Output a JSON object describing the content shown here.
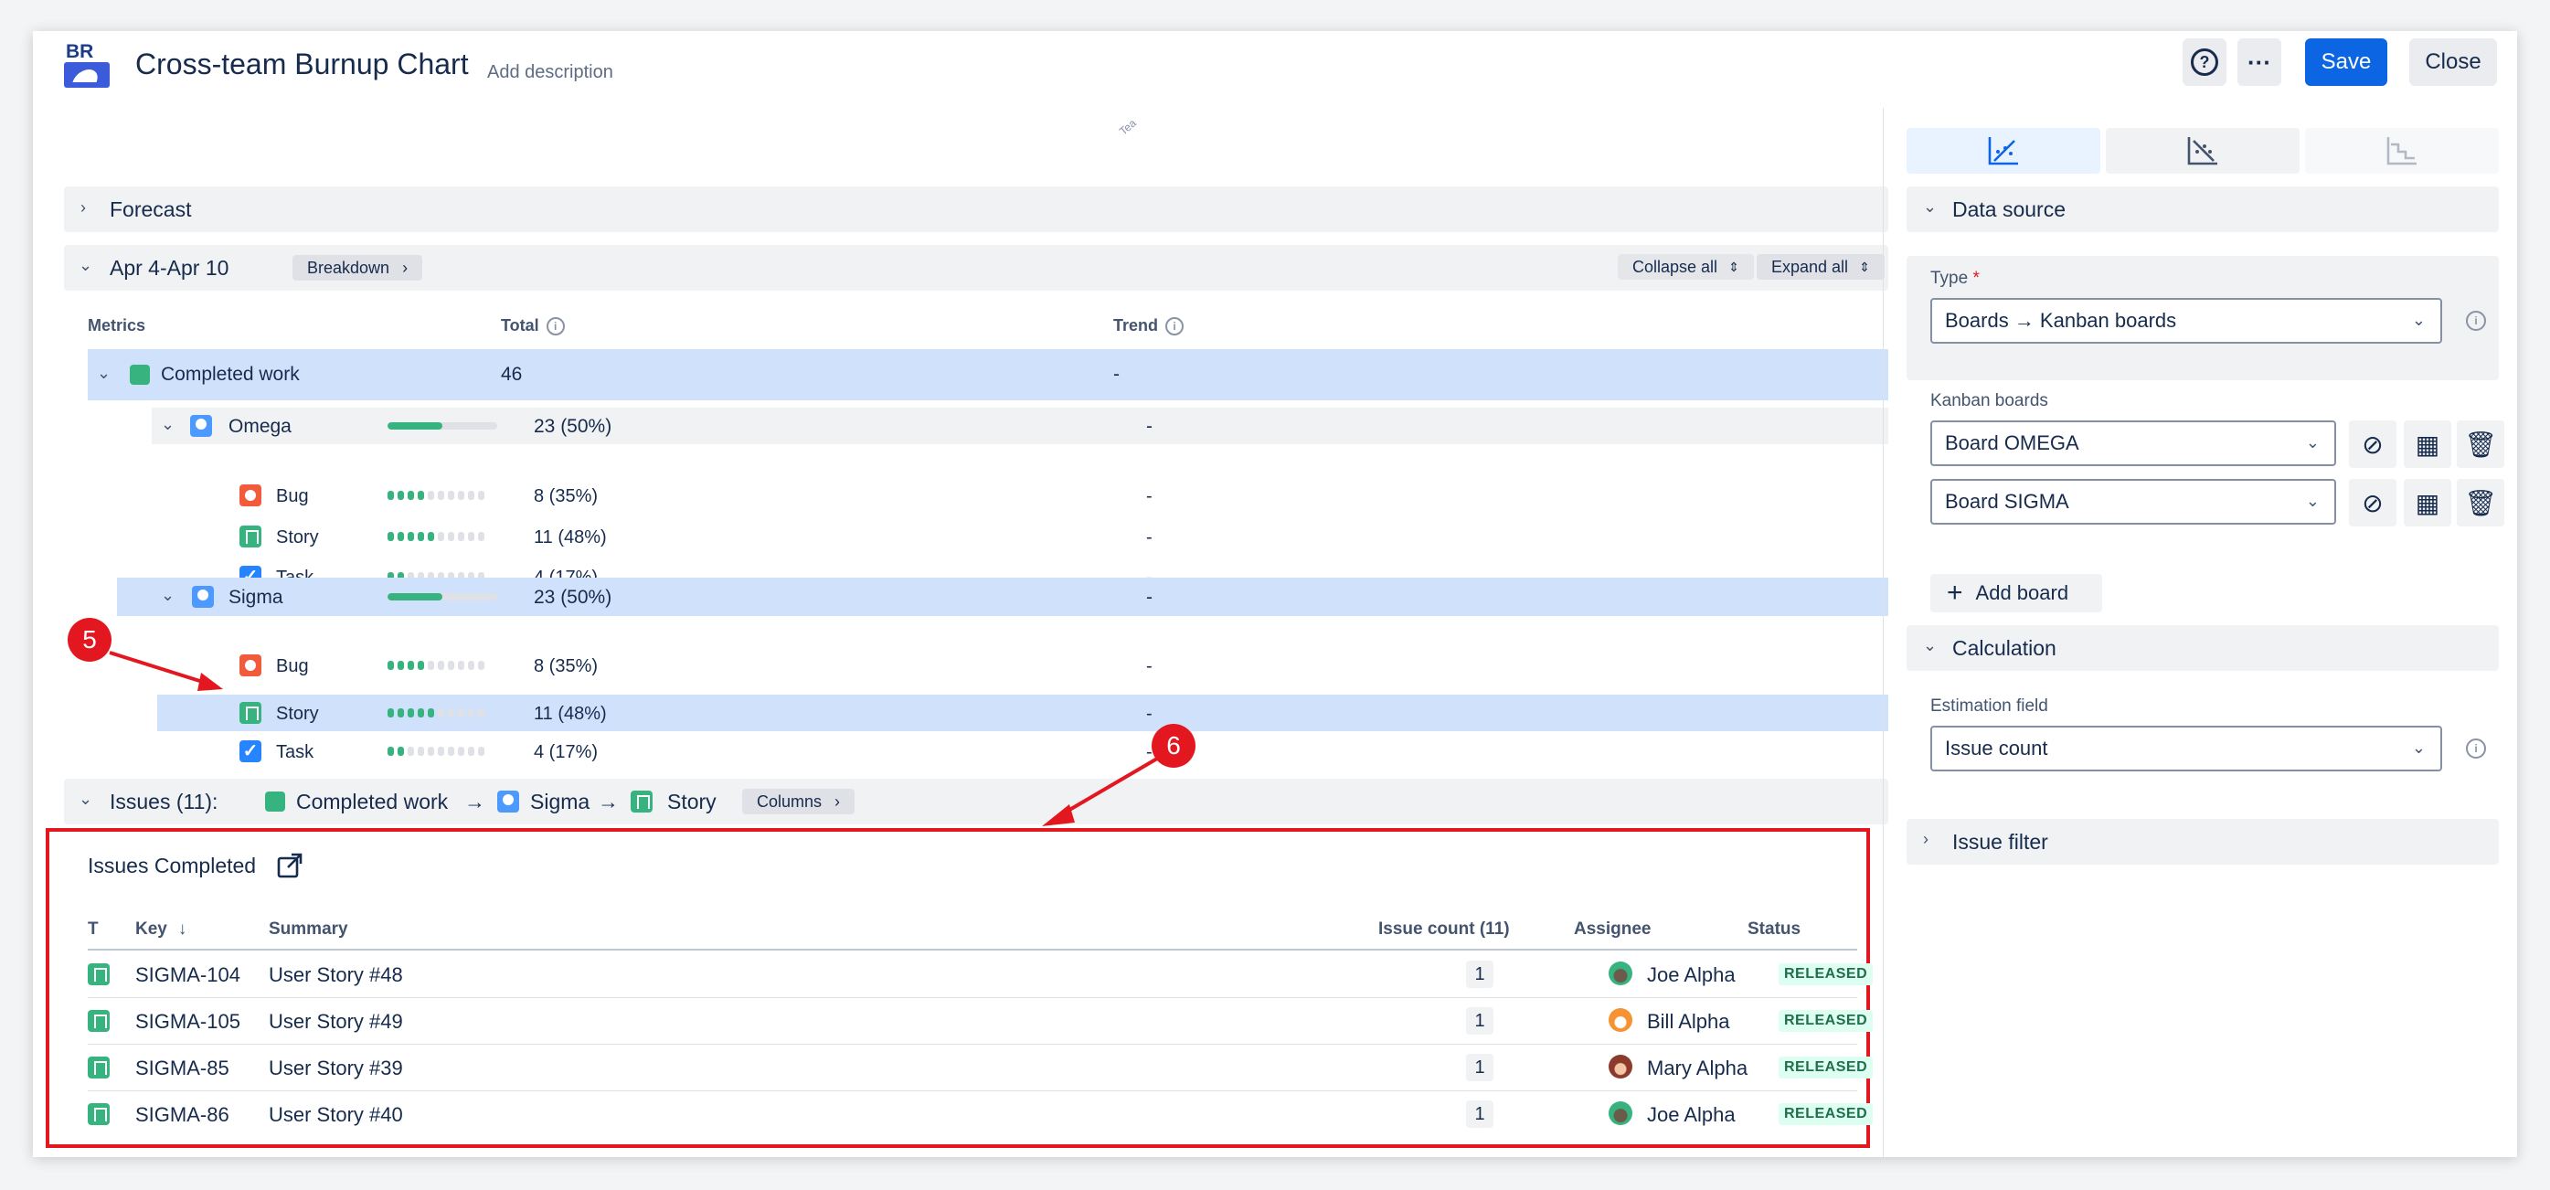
{
  "header": {
    "logo_text": "BR",
    "title": "Cross-team Burnup Chart",
    "add_description": "Add description",
    "help_label": "?",
    "more_label": "···",
    "save_label": "Save",
    "close_label": "Close"
  },
  "chart_stub": {
    "tick_label": "Tea"
  },
  "forecast": {
    "label": "Forecast"
  },
  "period": {
    "label": "Apr 4-Apr 10",
    "breakdown_label": "Breakdown",
    "collapse_all_label": "Collapse all",
    "expand_all_label": "Expand all"
  },
  "metrics": {
    "headers": {
      "metrics": "Metrics",
      "total": "Total",
      "trend": "Trend"
    },
    "completed": {
      "label": "Completed work",
      "total": "46",
      "trend": "-"
    },
    "teams": [
      {
        "name": "Omega",
        "total": "23 (50%)",
        "trend": "-",
        "progress": 0.5,
        "types": [
          {
            "name": "Bug",
            "total": "8 (35%)",
            "trend": "-",
            "progress": 0.35
          },
          {
            "name": "Story",
            "total": "11 (48%)",
            "trend": "-",
            "progress": 0.48
          },
          {
            "name": "Task",
            "total": "4 (17%)",
            "trend": "-",
            "progress": 0.17
          }
        ]
      },
      {
        "name": "Sigma",
        "total": "23 (50%)",
        "trend": "-",
        "progress": 0.5,
        "types": [
          {
            "name": "Bug",
            "total": "8 (35%)",
            "trend": "-",
            "progress": 0.35
          },
          {
            "name": "Story",
            "total": "11 (48%)",
            "trend": "-",
            "progress": 0.48
          },
          {
            "name": "Task",
            "total": "4 (17%)",
            "trend": "-",
            "progress": 0.17
          }
        ]
      }
    ]
  },
  "issues_breadcrumb": {
    "prefix": "Issues (11):",
    "completed": "Completed work",
    "team": "Sigma",
    "type": "Story",
    "arrow": "→",
    "columns_label": "Columns"
  },
  "issues_table": {
    "title": "Issues Completed",
    "headers": {
      "t": "T",
      "key": "Key",
      "summary": "Summary",
      "count": "Issue count (11)",
      "assignee": "Assignee",
      "status": "Status"
    },
    "rows": [
      {
        "key": "SIGMA-104",
        "summary": "User Story #48",
        "count": "1",
        "assignee": "Joe Alpha",
        "status": "RELEASED"
      },
      {
        "key": "SIGMA-105",
        "summary": "User Story #49",
        "count": "1",
        "assignee": "Bill Alpha",
        "status": "RELEASED"
      },
      {
        "key": "SIGMA-85",
        "summary": "User Story #39",
        "count": "1",
        "assignee": "Mary Alpha",
        "status": "RELEASED"
      },
      {
        "key": "SIGMA-86",
        "summary": "User Story #40",
        "count": "1",
        "assignee": "Joe Alpha",
        "status": "RELEASED"
      }
    ]
  },
  "annotations": {
    "five": "5",
    "six": "6"
  },
  "right_panel": {
    "data_source": {
      "label": "Data source",
      "type_label": "Type",
      "type_required": "*",
      "type_value": "Boards → Kanban boards",
      "kanban_label": "Kanban boards",
      "boards": [
        "Board OMEGA",
        "Board SIGMA"
      ],
      "add_board_label": "Add board"
    },
    "calculation": {
      "label": "Calculation",
      "estimation_label": "Estimation field",
      "estimation_value": "Issue count"
    },
    "issue_filter": {
      "label": "Issue filter"
    }
  },
  "colors": {
    "accent": "#0c66e4",
    "selected_row": "#cfe1fb",
    "annotation": "#e2171f",
    "progress": "#36b37e"
  }
}
